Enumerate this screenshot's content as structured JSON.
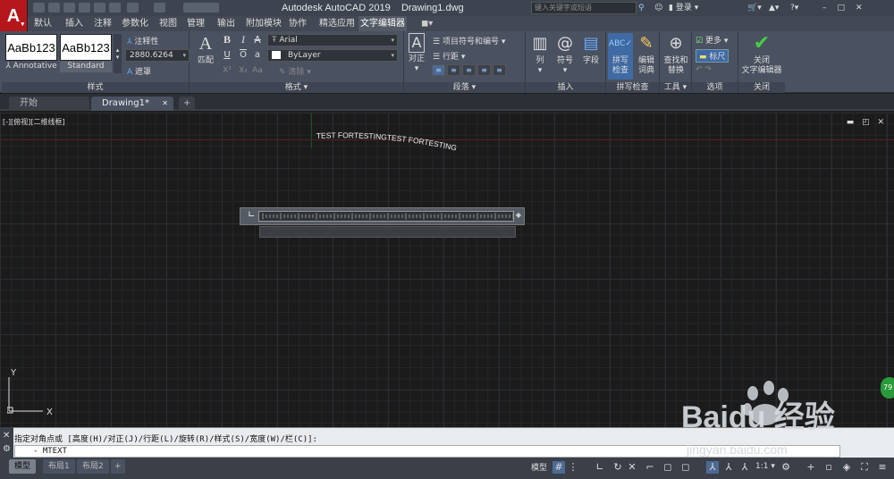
{
  "titlebar": {
    "app_title": "Autodesk AutoCAD 2019",
    "file_name": "Drawing1.dwg",
    "search_placeholder": "键入关键字或短语",
    "login_label": "登录"
  },
  "ribbon_tabs": [
    "默认",
    "插入",
    "注释",
    "参数化",
    "视图",
    "管理",
    "输出",
    "附加模块",
    "协作",
    "精选应用",
    "文字编辑器"
  ],
  "ribbon_active_tab": "文字编辑器",
  "ribbon": {
    "style_panel": {
      "styles": [
        {
          "preview": "AaBb123",
          "name": "Annotative"
        },
        {
          "preview": "AaBb123",
          "name": "Standard"
        }
      ],
      "annotative_label": "注释性",
      "height_value": "2880.6264",
      "mask_label": "遮罩",
      "label": "样式"
    },
    "format_panel": {
      "match_label": "匹配",
      "font": "Arial",
      "color": "ByLayer",
      "clear_label": "清除",
      "label": "格式"
    },
    "paragraph_panel": {
      "justify_label": "对正",
      "bullets_label": "项目符号和编号",
      "linespacing_label": "行距",
      "label": "段落"
    },
    "insert_panel": {
      "columns_label": "列",
      "symbol_label": "符号",
      "field_label": "字段",
      "label": "插入"
    },
    "spell_panel": {
      "spellcheck_label": "拼写\n检查",
      "dict_label": "编辑\n词典",
      "label": "拼写检查"
    },
    "tools_panel": {
      "find_label": "查找和\n替换",
      "label": "工具"
    },
    "options_panel": {
      "more_label": "更多",
      "ruler_label": "标尺",
      "label": "选项"
    },
    "close_panel": {
      "close_label": "关闭\n文字编辑器",
      "label": "关闭"
    }
  },
  "doc_tabs": [
    {
      "label": "开始",
      "active": false
    },
    {
      "label": "Drawing1*",
      "active": true
    }
  ],
  "canvas": {
    "view_label": "[-][俯视][二维线框]",
    "curved_text": "TEST FORTESTINGTEST FORTESTING",
    "ucs_y": "Y",
    "ucs_x": "X"
  },
  "command": {
    "prompt": "指定对角点或 [高度(H)/对正(J)/行距(L)/旋转(R)/样式(S)/宽度(W)/栏(C)]:",
    "current": "- MTEXT"
  },
  "statusbar": {
    "layout_tabs": [
      "模型",
      "布局1",
      "布局2"
    ],
    "active_layout": "模型",
    "model_label": "模型",
    "scale_label": "1:1"
  },
  "watermark": {
    "brand": "Baidu 经验",
    "url": "jingyan.baidu.com"
  },
  "badge": "79"
}
